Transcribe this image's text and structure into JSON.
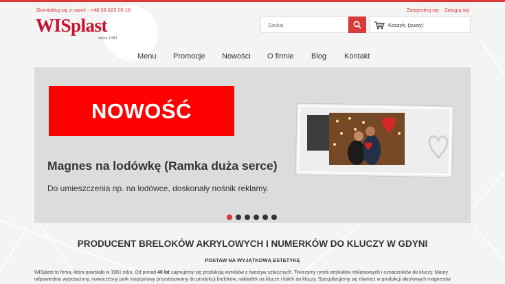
{
  "header": {
    "contact": "Skontaktuj się z nami! - +48 58 623 00 18",
    "register": "Zarejestruj się",
    "login": "Zaloguj się",
    "logo": "WISplast",
    "logo_since": "since 1981",
    "search_placeholder": "Szukaj",
    "cart_label": "Koszyk: (pusty)"
  },
  "nav": {
    "items": [
      "Menu",
      "Promocje",
      "Nowości",
      "O firmie",
      "Blog",
      "Kontakt"
    ]
  },
  "slider": {
    "badge": "NOWOŚĆ",
    "title": "Magnes na lodówkę (Ramka duża serce)",
    "subtitle": "Do umieszczenia np. na lodówce, doskonały nośnik reklamy.",
    "dot_count": 6,
    "active_dot": 1
  },
  "content": {
    "heading": "PRODUCENT BRELOKÓW AKRYLOWYCH I NUMERKÓW DO KLUCZY W GDYNI",
    "subheading": "POSTAW NA WYJĄTKOWĄ ESTETYKĘ",
    "para_part1": "WISplast to firma, która powstała w 1981 roku. Od ponad ",
    "para_bold": "40 lat",
    "para_part2": " zajmujemy się produkcją wyrobów z tworzyw sztucznych. Tworzymy rynek artykułów reklamowych i oznaczników do kluczy. Mamy odpowiednio wyposażony, nowoczesny park maszynowy przystosowany do produkcji breloków, nakładek na klucze i kółek do kluczy. Specjalizujemy się również w produkcji akrylowych magnesów"
  },
  "colors": {
    "accent": "#d83a3a",
    "logo": "#c8102e",
    "badge": "#ff0000"
  }
}
